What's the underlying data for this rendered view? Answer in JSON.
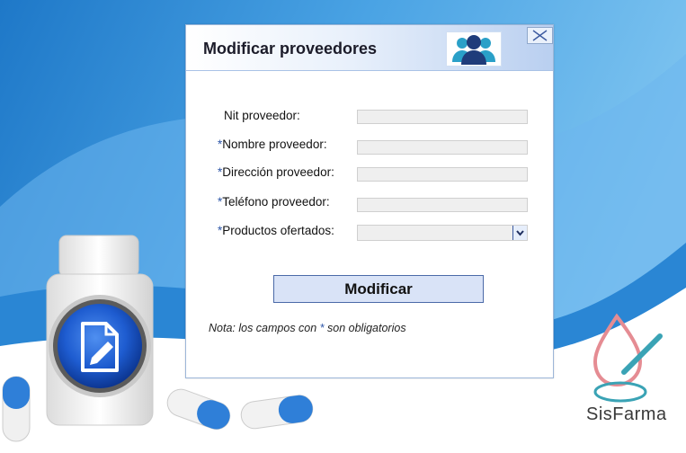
{
  "dialog": {
    "title": "Modificar proveedores",
    "close_icon": "close-icon",
    "header_icon": "users-icon"
  },
  "form": {
    "fields": [
      {
        "prefix": "",
        "label": "Nit proveedor:",
        "value": ""
      },
      {
        "prefix": "*",
        "label": "Nombre proveedor:",
        "value": ""
      },
      {
        "prefix": "*",
        "label": "Dirección proveedor:",
        "value": ""
      },
      {
        "prefix": "*",
        "label": "Teléfono proveedor:",
        "value": ""
      }
    ],
    "select": {
      "prefix": "*",
      "label": "Productos ofertados:",
      "value": ""
    },
    "submit_label": "Modificar",
    "note_before": "Nota: los campos con ",
    "note_asterisk": "*",
    "note_after": " son obligatorios"
  },
  "branding": {
    "logo_text": "SisFarma"
  },
  "colors": {
    "accent": "#2d56a8",
    "button_bg": "#d9e3f7",
    "background_blue": "#3b8fd6"
  }
}
